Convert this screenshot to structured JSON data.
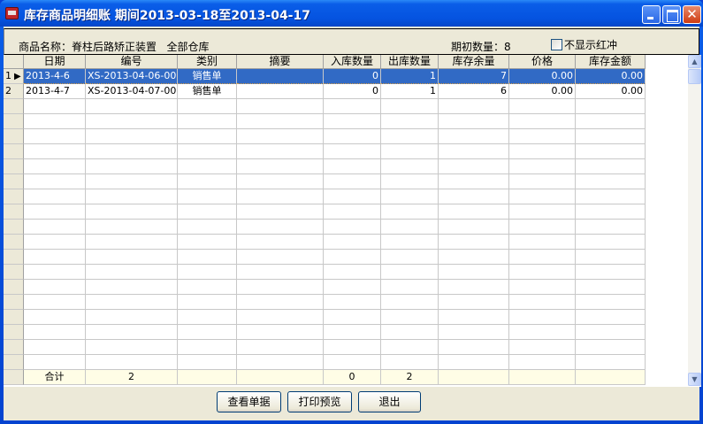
{
  "window": {
    "title": "库存商品明细账 期间2013-03-18至2013-04-17",
    "close_glyph": "✕"
  },
  "info": {
    "product": "商品名称：脊柱后路矫正装置   全部仓库",
    "initial_qty": "期初数量：8",
    "hide_red_label": "不显示红冲",
    "hide_red_checked": false
  },
  "grid": {
    "columns": [
      "日期",
      "编号",
      "类别",
      "摘要",
      "入库数量",
      "出库数量",
      "库存余量",
      "价格",
      "库存金额"
    ],
    "rows": [
      {
        "index": "1",
        "date": "2013-4-6",
        "number": "XS-2013-04-06-000",
        "type": "销售单",
        "summary": "",
        "in": "0",
        "out": "1",
        "balance": "7",
        "price": "0.00",
        "amount": "0.00",
        "selected": true
      },
      {
        "index": "2",
        "date": "2013-4-7",
        "number": "XS-2013-04-07-000",
        "type": "销售单",
        "summary": "",
        "in": "0",
        "out": "1",
        "balance": "6",
        "price": "0.00",
        "amount": "0.00",
        "selected": false
      }
    ],
    "footer": {
      "label": "合计",
      "count": "2",
      "in": "0",
      "out": "2"
    },
    "selection_marker": "▶"
  },
  "scrollbar": {
    "up": "▲",
    "down": "▼"
  },
  "buttons": {
    "view": "查看单据",
    "preview": "打印预览",
    "exit": "退出"
  }
}
